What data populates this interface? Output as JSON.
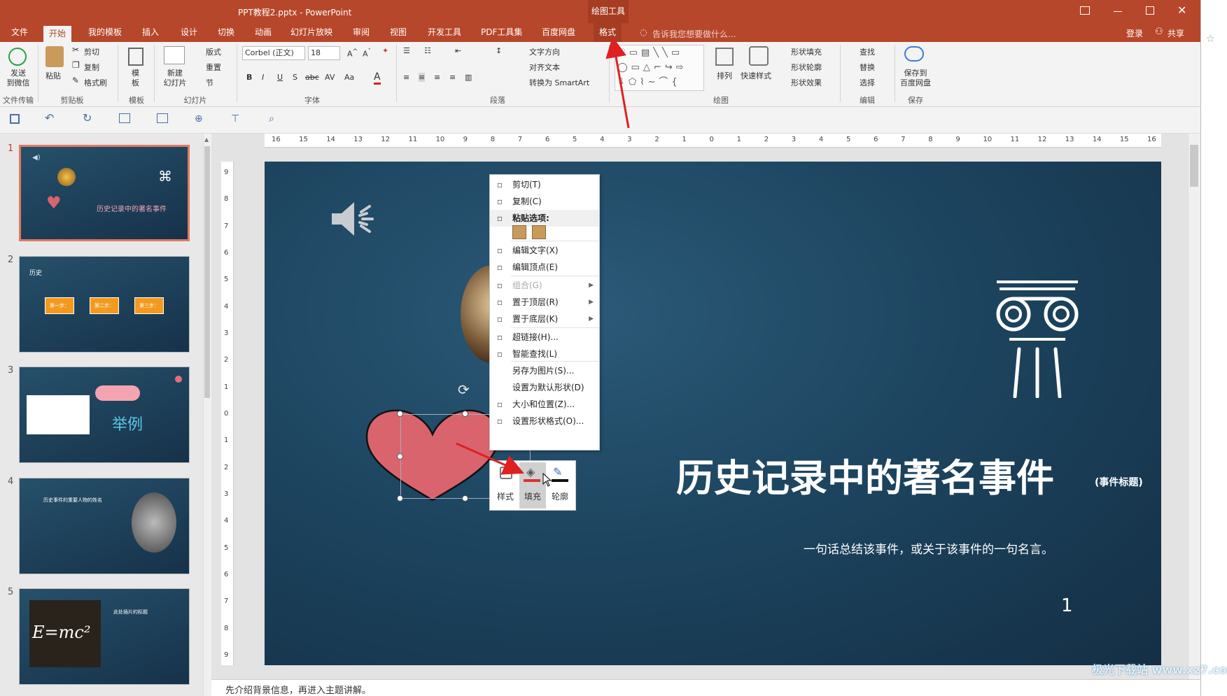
{
  "window": {
    "title": "PPT教程2.pptx - PowerPoint",
    "contextual_tab_group": "绘图工具",
    "controls": [
      "restore-icon",
      "minimize-icon",
      "maximize-icon",
      "close-icon"
    ]
  },
  "tabs": [
    "文件",
    "开始",
    "我的模板",
    "插入",
    "设计",
    "切换",
    "动画",
    "幻灯片放映",
    "审阅",
    "视图",
    "开发工具",
    "PDF工具集",
    "百度网盘",
    "格式"
  ],
  "active_tab": "开始",
  "tell_me": "告诉我您想要做什么...",
  "account": {
    "signin": "登录",
    "share": "共享"
  },
  "ribbon": {
    "send_label": "发送\n到微信",
    "group_file": "文件传输",
    "paste": "粘贴",
    "cut": "剪切",
    "copy": "复制",
    "format_painter": "格式刷",
    "group_clipboard": "剪贴板",
    "template": "模\n板",
    "group_template": "模板",
    "new_slide": "新建\n幻灯片",
    "layout": "版式",
    "reset": "重置",
    "section": "节",
    "group_slides": "幻灯片",
    "font_name": "Corbel (正文)",
    "font_size": "18",
    "group_font": "字体",
    "text_direction": "文字方向",
    "align_text": "对齐文本",
    "convert_smartart": "转换为 SmartArt",
    "group_paragraph": "段落",
    "arrange": "排列",
    "quick_styles": "快速样式",
    "shape_fill": "形状填充",
    "shape_outline": "形状轮廓",
    "shape_effects": "形状效果",
    "group_drawing": "绘图",
    "find": "查找",
    "replace": "替换",
    "select": "选择",
    "group_editing": "编辑",
    "save_baidu": "保存到\n百度网盘",
    "group_save": "保存"
  },
  "slides": [
    {
      "num": "1",
      "title": "历史记录中的著名事件"
    },
    {
      "num": "2",
      "title": "历史",
      "steps": [
        "第一步：",
        "第二步：",
        "第三步："
      ]
    },
    {
      "num": "3",
      "title": "举例"
    },
    {
      "num": "4",
      "title": "历史事件的重要人物的姓名"
    },
    {
      "num": "5",
      "title": "此处插片的标题",
      "formula": "E=mc²"
    }
  ],
  "ruler_h": [
    "16",
    "15",
    "14",
    "13",
    "12",
    "11",
    "10",
    "9",
    "8",
    "7",
    "6",
    "5",
    "4",
    "3",
    "2",
    "1",
    "0",
    "1",
    "2",
    "3",
    "4",
    "5",
    "6",
    "7",
    "8",
    "9",
    "10",
    "11",
    "12",
    "13",
    "14",
    "15",
    "16"
  ],
  "ruler_v": [
    "9",
    "8",
    "7",
    "6",
    "5",
    "4",
    "3",
    "2",
    "1",
    "0",
    "1",
    "2",
    "3",
    "4",
    "5",
    "6",
    "7",
    "8",
    "9"
  ],
  "slide": {
    "title": "历史记录中的著名事件",
    "title_note": "(事件标题)",
    "subtitle": "一句话总结该事件，或关于该事件的一句名言。",
    "page_number": "1",
    "heart_color": "#d9646e",
    "bg_color": "#1d4560"
  },
  "context_menu": {
    "items": [
      {
        "label": "剪切(T)",
        "icon": "scissors-icon",
        "disabled": false
      },
      {
        "label": "复制(C)",
        "icon": "copy-icon",
        "disabled": false
      },
      {
        "label": "粘贴选项:",
        "icon": "paste-icon",
        "disabled": false,
        "header": true
      },
      {
        "label": "编辑文字(X)",
        "icon": "edit-text-icon",
        "disabled": false
      },
      {
        "label": "编辑顶点(E)",
        "icon": "edit-points-icon",
        "disabled": false
      },
      {
        "label": "组合(G)",
        "icon": "group-icon",
        "disabled": true,
        "submenu": true
      },
      {
        "label": "置于顶层(R)",
        "icon": "bring-front-icon",
        "disabled": false,
        "submenu": true
      },
      {
        "label": "置于底层(K)",
        "icon": "send-back-icon",
        "disabled": false,
        "submenu": true
      },
      {
        "label": "超链接(H)...",
        "icon": "hyperlink-icon",
        "disabled": false
      },
      {
        "label": "智能查找(L)",
        "icon": "smart-lookup-icon",
        "disabled": false
      },
      {
        "label": "另存为图片(S)...",
        "icon": "",
        "disabled": false
      },
      {
        "label": "设置为默认形状(D)",
        "icon": "",
        "disabled": false
      },
      {
        "label": "大小和位置(Z)...",
        "icon": "size-position-icon",
        "disabled": false
      },
      {
        "label": "设置形状格式(O)...",
        "icon": "format-shape-icon",
        "disabled": false
      }
    ]
  },
  "mini_toolbar": {
    "style": "样式",
    "fill": "填充",
    "outline": "轮廓",
    "fill_color": "#e03030"
  },
  "notes": "先介绍背景信息，再进入主题讲解。",
  "watermark": "极光下载站 www.xz7.com",
  "accent_color": "#b7472a"
}
